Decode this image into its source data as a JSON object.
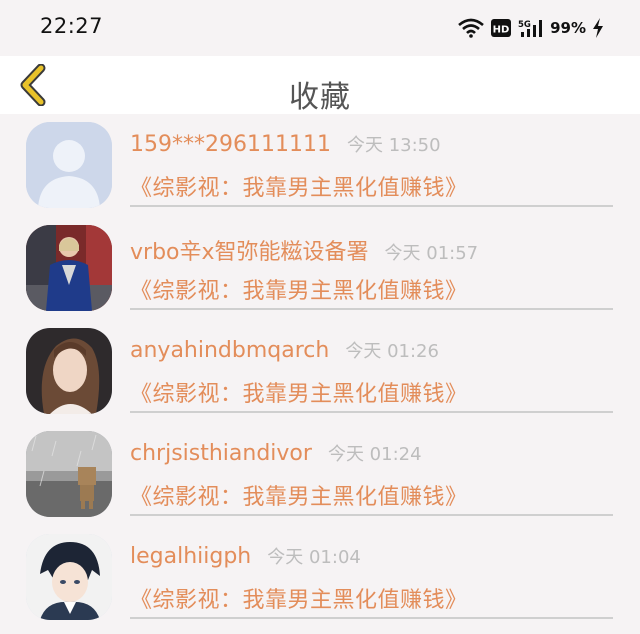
{
  "status": {
    "time": "22:27",
    "battery": "99%",
    "icons": [
      "wifi-icon",
      "hd-icon",
      "5g-signal-icon",
      "charging-icon"
    ],
    "hd_label": "HD",
    "network_label": "5G"
  },
  "header": {
    "back_icon": "chevron-left-icon",
    "title": "收藏"
  },
  "colors": {
    "accent": "#e38d5a",
    "back_icon": "#e8c22a",
    "time_text": "#bdbdbd"
  },
  "favorites": [
    {
      "name": "159***296111111",
      "time": "今天 13:50",
      "book": "《综影视：我靠男主黑化值赚钱》",
      "avatar": "default-avatar"
    },
    {
      "name": "vrbo辛x智弥能糍设备署",
      "time": "今天 01:57",
      "book": "《综影视：我靠男主黑化值赚钱》",
      "avatar": "woman-blue-jacket"
    },
    {
      "name": "anyahindbmqarch",
      "time": "今天 01:26",
      "book": "《综影视：我靠男主黑化值赚钱》",
      "avatar": "woman-portrait"
    },
    {
      "name": "chrjsisthiandivor",
      "time": "今天 01:24",
      "book": "《综影视：我靠男主黑化值赚钱》",
      "avatar": "cardboard-figure-rain"
    },
    {
      "name": "legalhiigph",
      "time": "今天 01:04",
      "book": "《综影视：我靠男主黑化值赚钱》",
      "avatar": "anime-boy"
    }
  ]
}
